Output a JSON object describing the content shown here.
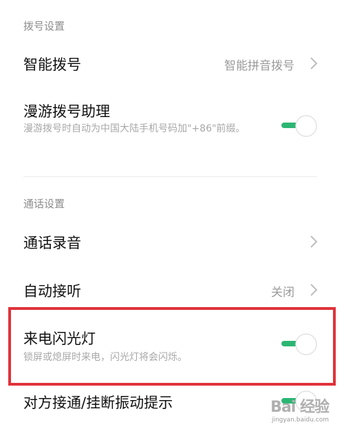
{
  "sections": {
    "dial": {
      "header": "拨号设置"
    },
    "call": {
      "header": "通话设置"
    }
  },
  "rows": {
    "smart_dial": {
      "title": "智能拨号",
      "value": "智能拼音拨号"
    },
    "roaming": {
      "title": "漫游拨号助理",
      "subtitle": "漫游拨号时自动为中国大陆手机号码加\"+86\"前缀。",
      "enabled": true
    },
    "recording": {
      "title": "通话录音"
    },
    "auto_answer": {
      "title": "自动接听",
      "value": "关闭"
    },
    "flash": {
      "title": "来电闪光灯",
      "subtitle": "锁屏或熄屏时来电，闪光灯将会闪烁。",
      "enabled": true
    },
    "vibrate": {
      "title": "对方接通/挂断振动提示"
    }
  },
  "colors": {
    "toggle_on": "#2bb673",
    "highlight": "#e0323a"
  },
  "watermark": {
    "brand": "Bai 经验",
    "url": "jingyan.baidu.com"
  }
}
